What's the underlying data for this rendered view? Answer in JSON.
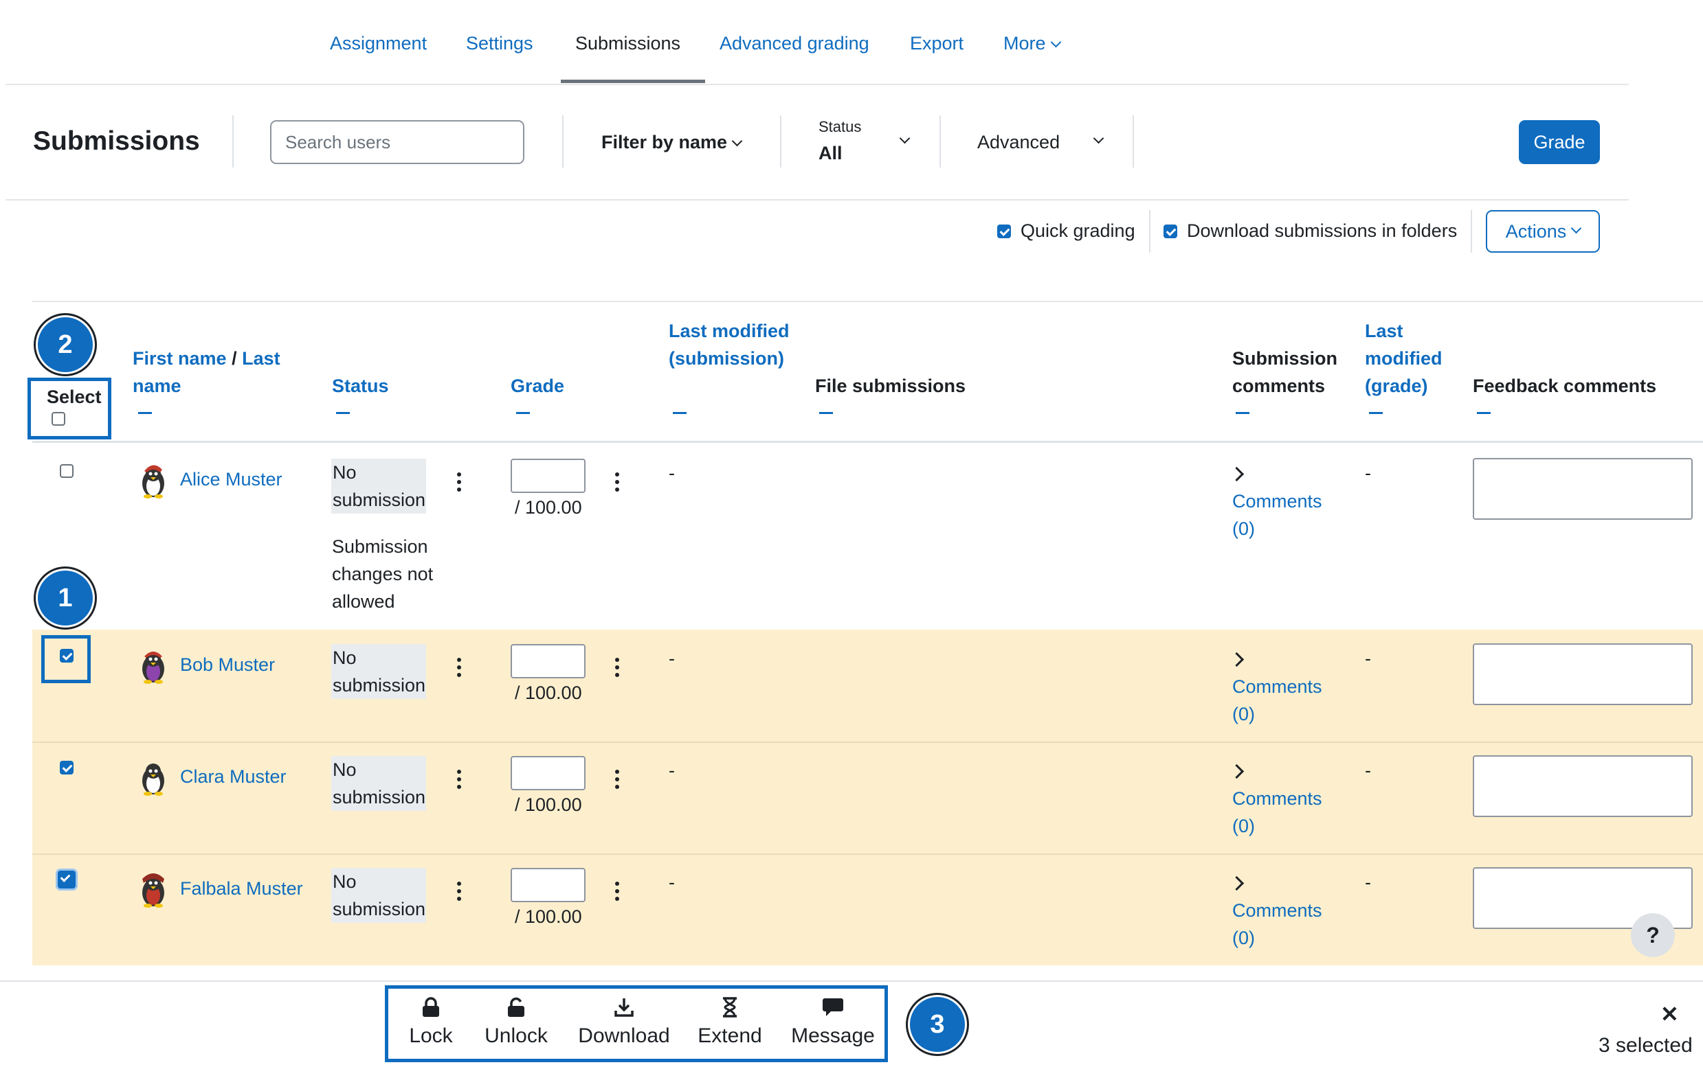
{
  "nav": {
    "items": [
      "Assignment",
      "Settings",
      "Submissions",
      "Advanced grading",
      "Export",
      "More"
    ]
  },
  "toolbar": {
    "title": "Submissions",
    "search_placeholder": "Search users",
    "filter_by_name": "Filter by name",
    "status_label": "Status",
    "status_value": "All",
    "advanced": "Advanced",
    "grade_button": "Grade"
  },
  "options": {
    "quick_grading": "Quick grading",
    "quick_grading_checked": true,
    "download_folders": "Download submissions in folders",
    "download_folders_checked": true,
    "actions": "Actions"
  },
  "table": {
    "headers": {
      "select": "Select",
      "first_name": "First name",
      "slash": "/",
      "last_name": "Last name",
      "status": "Status",
      "grade": "Grade",
      "last_modified_submission": "Last modified (submission)",
      "file_submissions": "File submissions",
      "submission_comments": "Submission comments",
      "last_modified_grade": "Last modified (grade)",
      "feedback_comments": "Feedback comments"
    },
    "rows": [
      {
        "name": "Alice Muster",
        "selected": false,
        "status": "No submission",
        "note": "Submission changes not allowed",
        "grade_max": "/ 100.00",
        "last_modified": "-",
        "comments": "Comments (0)",
        "last_modified_grade": "-"
      },
      {
        "name": "Bob Muster",
        "selected": true,
        "status": "No submission",
        "note": "",
        "grade_max": "/ 100.00",
        "last_modified": "-",
        "comments": "Comments (0)",
        "last_modified_grade": "-"
      },
      {
        "name": "Clara Muster",
        "selected": true,
        "status": "No submission",
        "note": "",
        "grade_max": "/ 100.00",
        "last_modified": "-",
        "comments": "Comments (0)",
        "last_modified_grade": "-"
      },
      {
        "name": "Falbala Muster",
        "selected": true,
        "status": "No submission",
        "note": "",
        "grade_max": "/ 100.00",
        "last_modified": "-",
        "comments": "Comments (0)",
        "last_modified_grade": "-"
      }
    ]
  },
  "callouts": [
    "1",
    "2",
    "3"
  ],
  "bulk_actions": {
    "lock": "Lock",
    "unlock": "Unlock",
    "download": "Download",
    "extend": "Extend",
    "message": "Message",
    "selected_count": "3 selected",
    "close": "✕"
  },
  "help": "?",
  "colors": {
    "primary": "#0f6cbf",
    "selected_row": "#fdefcd",
    "badge_gray": "#e9ecef"
  }
}
